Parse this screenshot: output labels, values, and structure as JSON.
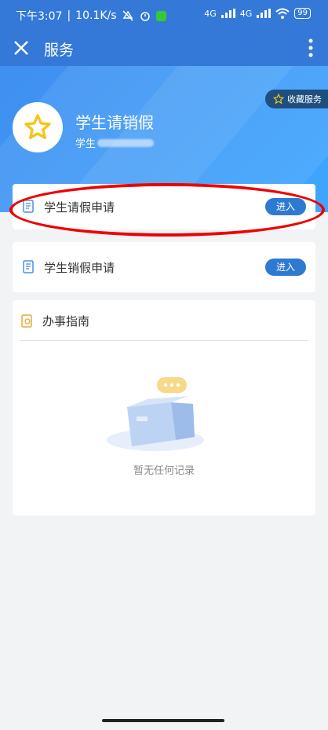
{
  "status": {
    "time": "下午3:07",
    "speed": "10.1K/s",
    "battery": "99",
    "net1": "4G",
    "net2": "4G"
  },
  "appbar": {
    "title": "服务",
    "close_icon": "close-icon",
    "more_icon": "more-vert-icon"
  },
  "banner": {
    "favorite_label": "收藏服务",
    "service_title": "学生请销假",
    "service_sub_prefix": "学生"
  },
  "cards": [
    {
      "label": "学生请假申请",
      "button": "进入",
      "icon": "form-icon"
    },
    {
      "label": "学生销假申请",
      "button": "进入",
      "icon": "form-icon"
    }
  ],
  "guide": {
    "title": "办事指南",
    "empty_text": "暂无任何记录"
  },
  "colors": {
    "primary": "#3479d8",
    "button": "#2f7ad1",
    "highlight": "#ee0000",
    "star": "#f5c518"
  }
}
